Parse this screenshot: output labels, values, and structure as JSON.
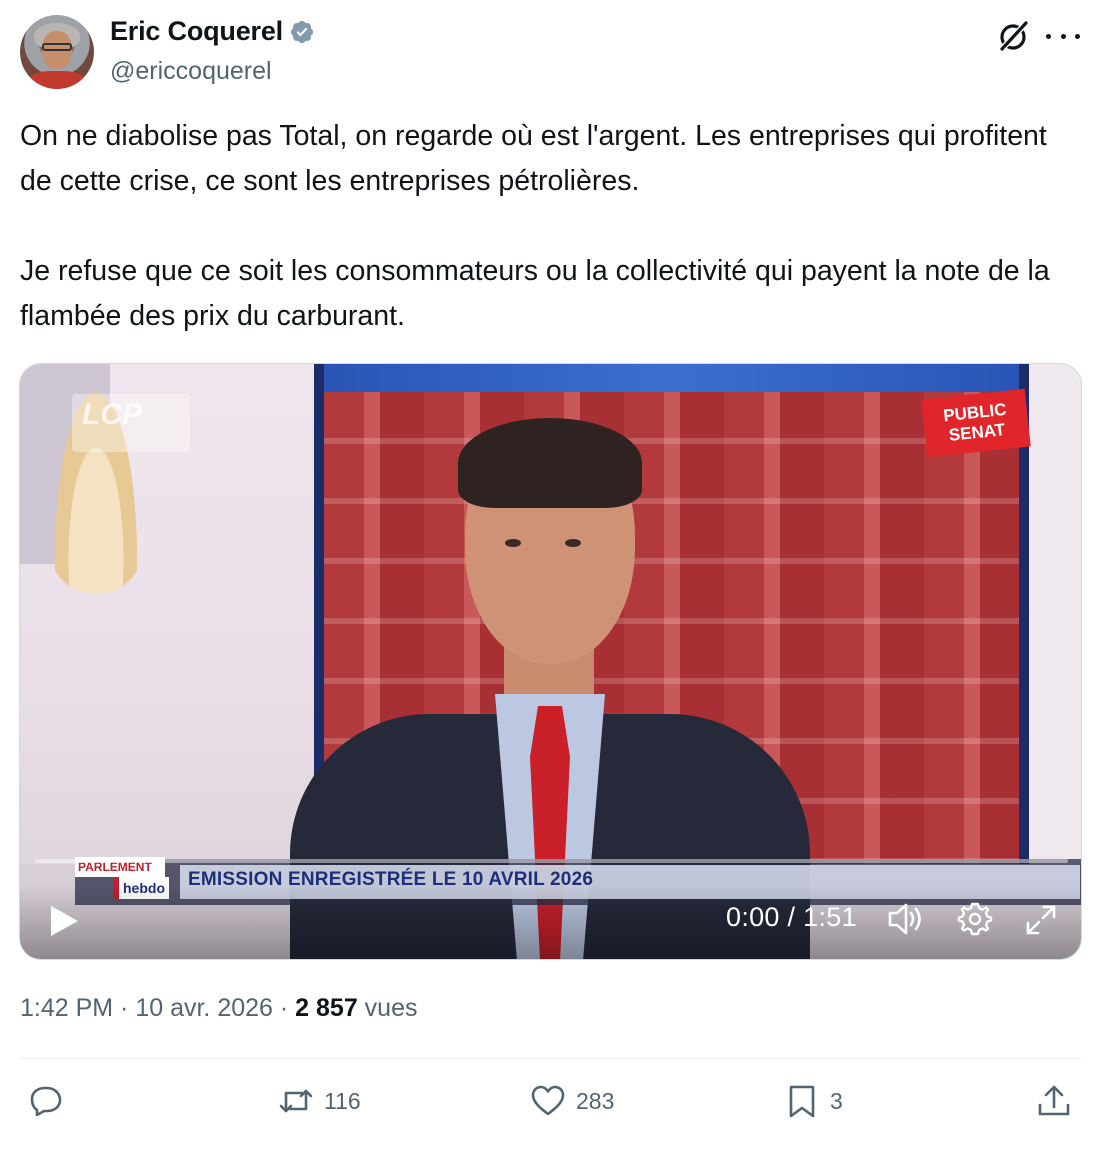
{
  "author": {
    "display_name": "Eric Coquerel",
    "handle": "@ericcoquerel",
    "verified": true
  },
  "tweet": {
    "paragraphs": [
      "On ne diabolise pas Total, on regarde où est l'argent. Les entreprises qui profitent de cette crise, ce sont les entreprises pétrolières.",
      "Je refuse que ce soit les consommateurs ou la collectivité qui payent la note de la flambée des prix du carburant."
    ]
  },
  "video": {
    "channel_logo_left": "LCP",
    "channel_logo_right": "PUBLIC SENAT",
    "show_logo_top": "PARLEMENT",
    "show_logo_bottom": "hebdo",
    "banner_text": "EMISSION ENREGISTRÉE LE 10 AVRIL 2026",
    "time_display": "0:00 / 1:51",
    "progress": 0
  },
  "meta": {
    "time": "1:42 PM",
    "separator": " · ",
    "date": "10 avr. 2026",
    "views_count": "2 857",
    "views_label": " vues"
  },
  "actions": {
    "replies": "",
    "reposts": "116",
    "likes": "283",
    "bookmarks": "3"
  },
  "colors": {
    "text": "#0f1419",
    "muted": "#536471",
    "verified": "#829aab",
    "border": "#eff3f4"
  }
}
